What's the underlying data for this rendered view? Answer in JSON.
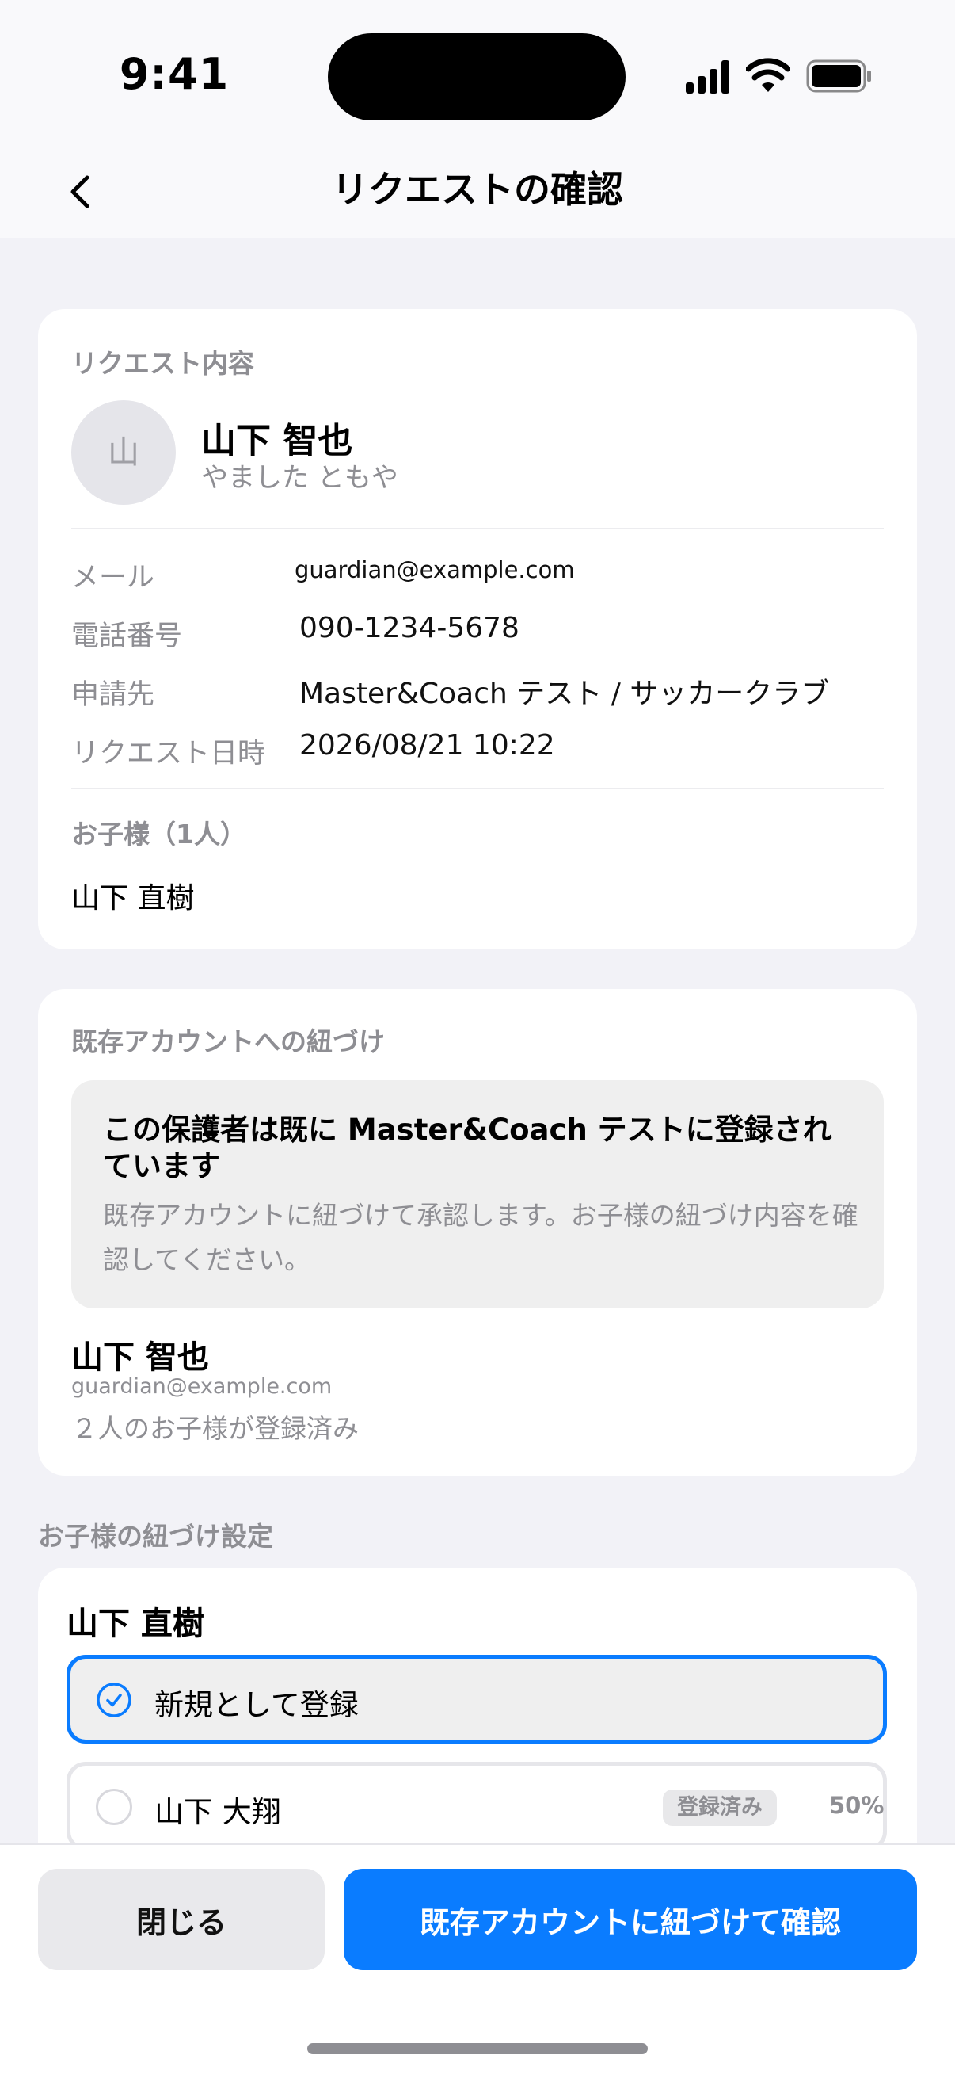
{
  "status_bar": {
    "time": "9:41"
  },
  "nav": {
    "title": "リクエストの確認"
  },
  "request": {
    "section_label": "リクエスト内容",
    "avatar_initial": "山",
    "name": "山下 智也",
    "name_kana": "やました ともや",
    "rows": [
      {
        "label": "メール",
        "value": "guardian@example.com"
      },
      {
        "label": "電話番号",
        "value": "090-1234-5678"
      },
      {
        "label": "申請先",
        "value": "Master&Coach テスト / サッカークラブ"
      },
      {
        "label": "リクエスト日時",
        "value": "2026/08/21 10:22"
      }
    ],
    "children_label": "お子様（1人）",
    "children": [
      "山下 直樹"
    ]
  },
  "existing": {
    "section_label": "既存アカウントへの紐づけ",
    "notice_title": "この保護者は既に Master&Coach テストに登録されています",
    "notice_body": "既存アカウントに紐づけて承認します。お子様の紐づけ内容を確認してください。",
    "account_name": "山下 智也",
    "account_email": "guardian@example.com",
    "account_children": "２人のお子様が登録済み"
  },
  "link_settings": {
    "section_label": "お子様の紐づけ設定",
    "child_name": "山下 直樹",
    "options": [
      {
        "label": "新規として登録",
        "selected": true
      },
      {
        "label": "山下 大翔",
        "selected": false,
        "badge": "登録済み",
        "match": "50%"
      }
    ]
  },
  "actions": {
    "close_label": "閉じる",
    "confirm_label": "既存アカウントに紐づけて確認"
  },
  "colors": {
    "accent": "#0a7cff",
    "background": "#f2f2f7",
    "muted_text": "#8e8e93"
  }
}
